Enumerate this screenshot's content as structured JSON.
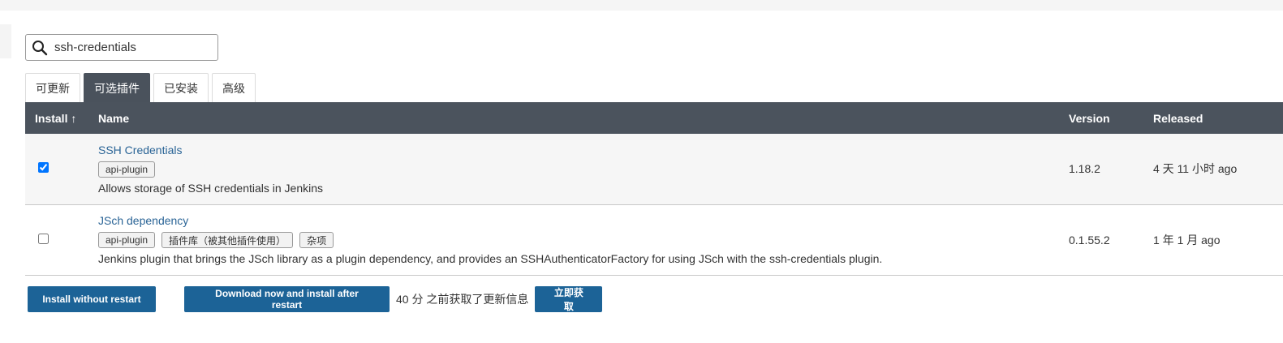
{
  "search": {
    "value": "ssh-credentials",
    "placeholder": ""
  },
  "tabs": [
    {
      "label": "可更新",
      "active": false
    },
    {
      "label": "可选插件",
      "active": true
    },
    {
      "label": "已安装",
      "active": false
    },
    {
      "label": "高级",
      "active": false
    }
  ],
  "table": {
    "headers": {
      "install": "Install ↑",
      "name": "Name",
      "version": "Version",
      "released": "Released"
    },
    "rows": [
      {
        "checked": true,
        "name": "SSH Credentials",
        "labels": [
          "api-plugin"
        ],
        "description": "Allows storage of SSH credentials in Jenkins",
        "version": "1.18.2",
        "released": "4 天 11 小时 ago"
      },
      {
        "checked": false,
        "name": "JSch dependency",
        "labels": [
          "api-plugin",
          "插件库（被其他插件使用）",
          "杂项"
        ],
        "description": "Jenkins plugin that brings the JSch library as a plugin dependency, and provides an SSHAuthenticatorFactory for using JSch with the ssh-credentials plugin.",
        "version": "0.1.55.2",
        "released": "1 年 1 月 ago"
      }
    ]
  },
  "actions": {
    "install_without_restart": "Install without restart",
    "download_and_install": "Download now and install after restart",
    "update_info": "40 分 之前获取了更新信息",
    "fetch_now": "立即获取"
  },
  "colors": {
    "header_bg": "#4b535d",
    "button_bg": "#1c6397",
    "link": "#2a6496"
  },
  "icons": {
    "search": "search-icon"
  }
}
